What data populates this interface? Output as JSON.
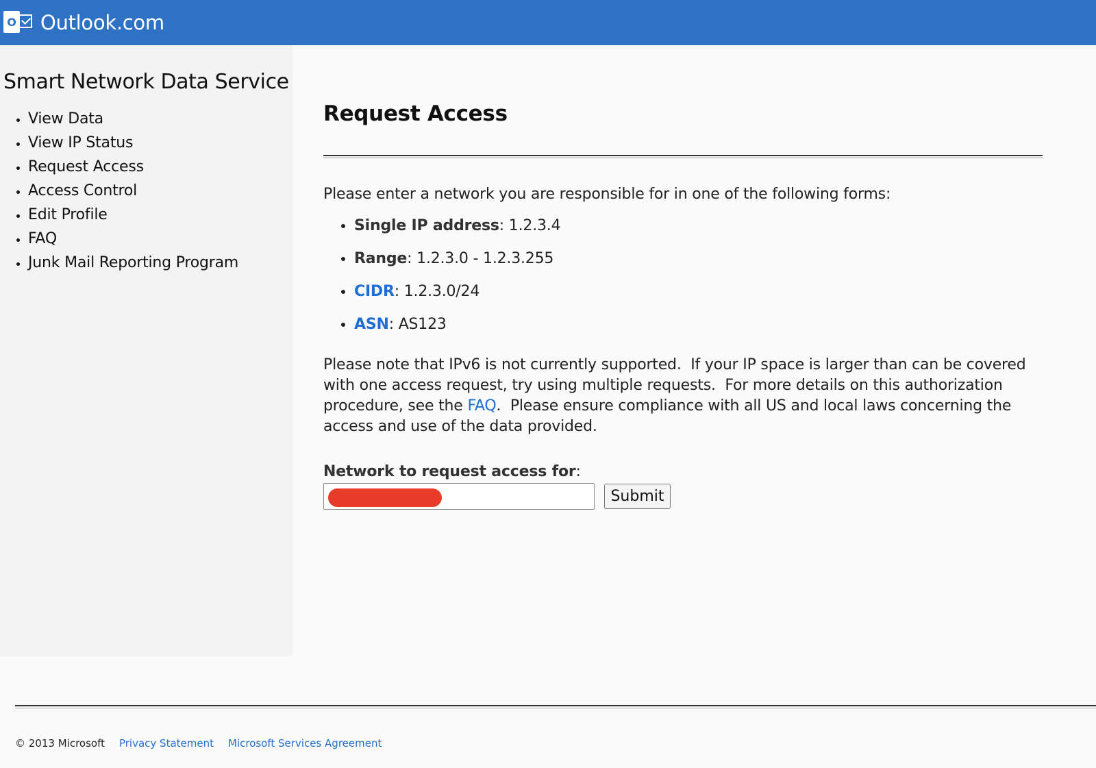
{
  "header": {
    "logo_letter": "O",
    "brand": "Outlook.com",
    "bg_color": "#2f72c4"
  },
  "sidebar": {
    "title": "Smart Network Data Service",
    "items": [
      {
        "label": "View Data"
      },
      {
        "label": "View IP Status"
      },
      {
        "label": "Request Access"
      },
      {
        "label": "Access Control"
      },
      {
        "label": "Edit Profile"
      },
      {
        "label": "FAQ"
      },
      {
        "label": "Junk Mail Reporting Program"
      }
    ]
  },
  "main": {
    "title": "Request Access",
    "intro": "Please enter a network you are responsible for in one of the following forms:",
    "forms": [
      {
        "term": "Single IP address",
        "example": ": 1.2.3.4",
        "link": false
      },
      {
        "term": "Range",
        "example": ": 1.2.3.0 - 1.2.3.255",
        "link": false
      },
      {
        "term": "CIDR",
        "example": ": 1.2.3.0/24",
        "link": true
      },
      {
        "term": "ASN",
        "example": ": AS123",
        "link": true
      }
    ],
    "note_part1": "Please note that IPv6 is not currently supported.  If your IP space is larger than can be covered with one access request, try using multiple requests.  For more details on this authorization procedure, see the ",
    "note_link": "FAQ",
    "note_part2": ".  Please ensure compliance with all US and local laws concerning the access and use of the data provided.",
    "field_label": "Network to request access for",
    "field_label_suffix": ":",
    "field_value": "",
    "submit_label": "Submit"
  },
  "footer": {
    "copyright": "© 2013 Microsoft",
    "privacy": "Privacy Statement",
    "agreement": "Microsoft Services Agreement"
  },
  "colors": {
    "link": "#1f6fd0",
    "redaction": "#e63c28"
  }
}
